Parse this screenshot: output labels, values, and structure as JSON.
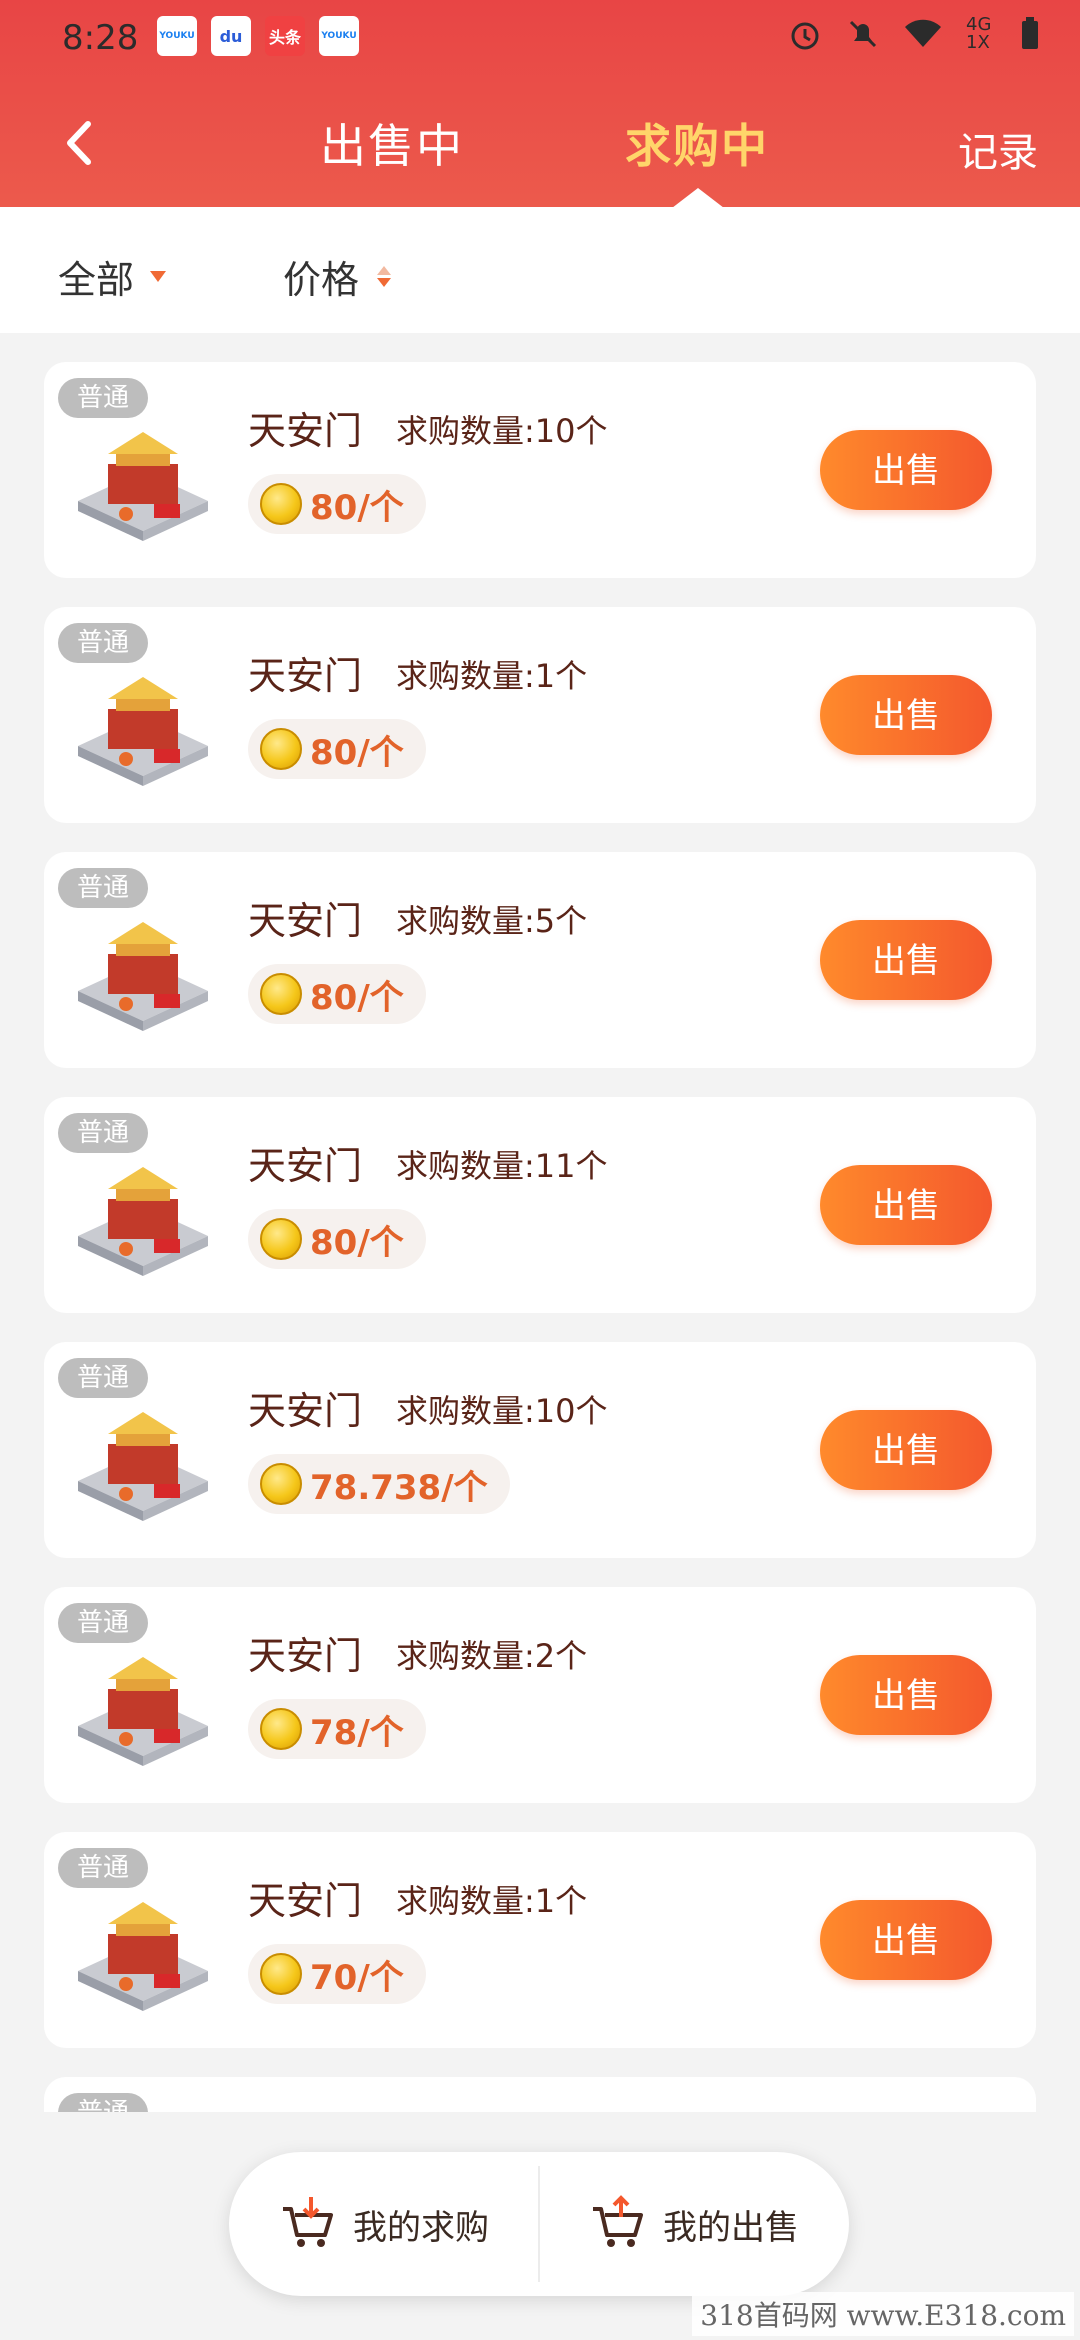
{
  "status_bar": {
    "time": "8:28",
    "apps": [
      "YOUKU",
      "du",
      "头条",
      "YOUKU"
    ],
    "network": "4G 1X"
  },
  "nav": {
    "tabs": [
      {
        "label": "出售中",
        "active": false
      },
      {
        "label": "求购中",
        "active": true
      }
    ],
    "record_label": "记录"
  },
  "filters": {
    "all_label": "全部",
    "price_label": "价格"
  },
  "orders": [
    {
      "badge": "普通",
      "name": "天安门",
      "qty": "求购数量:10个",
      "price": "80/个",
      "action": "出售"
    },
    {
      "badge": "普通",
      "name": "天安门",
      "qty": "求购数量:1个",
      "price": "80/个",
      "action": "出售"
    },
    {
      "badge": "普通",
      "name": "天安门",
      "qty": "求购数量:5个",
      "price": "80/个",
      "action": "出售"
    },
    {
      "badge": "普通",
      "name": "天安门",
      "qty": "求购数量:11个",
      "price": "80/个",
      "action": "出售"
    },
    {
      "badge": "普通",
      "name": "天安门",
      "qty": "求购数量:10个",
      "price": "78.738/个",
      "action": "出售"
    },
    {
      "badge": "普通",
      "name": "天安门",
      "qty": "求购数量:2个",
      "price": "78/个",
      "action": "出售"
    },
    {
      "badge": "普通",
      "name": "天安门",
      "qty": "求购数量:1个",
      "price": "70/个",
      "action": "出售"
    },
    {
      "badge": "普通",
      "name": "",
      "qty": "",
      "price": "",
      "action": ""
    }
  ],
  "bottom": {
    "my_buy_label": "我的求购",
    "my_sell_label": "我的出售"
  },
  "watermark": "318首码网 www.E318.com",
  "colors": {
    "header": "#e84545",
    "active_tab": "#ffd56a",
    "accent": "#f4582d",
    "price": "#e2632a"
  }
}
